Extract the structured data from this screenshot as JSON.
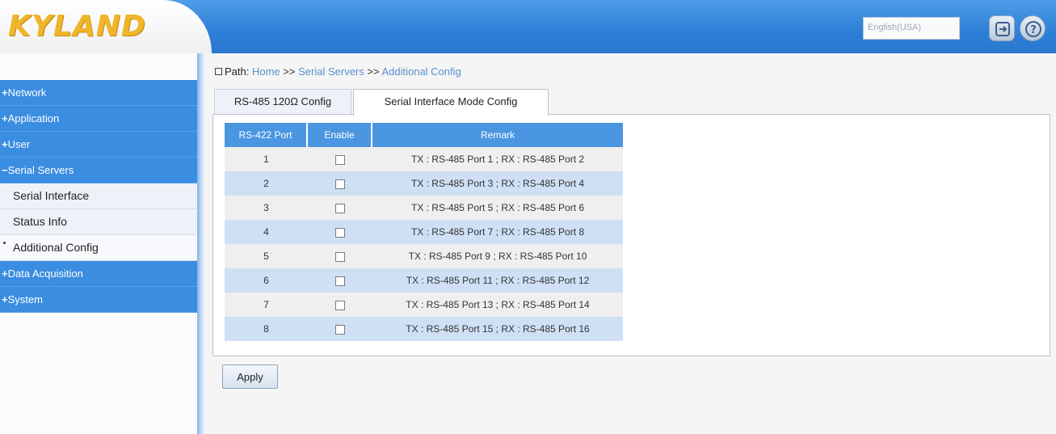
{
  "header": {
    "logo_text": "KYLAND",
    "language": "English(USA)",
    "logout_icon": "logout-icon",
    "help_icon": "help-icon"
  },
  "sidebar": {
    "items": [
      {
        "label": "Network",
        "sign": "+",
        "type": "group"
      },
      {
        "label": "Application",
        "sign": "+",
        "type": "group"
      },
      {
        "label": "User",
        "sign": "+",
        "type": "group"
      },
      {
        "label": "Serial Servers",
        "sign": "−",
        "type": "group"
      },
      {
        "label": "Serial Interface",
        "type": "sub"
      },
      {
        "label": "Status Info",
        "type": "sub"
      },
      {
        "label": "Additional Config",
        "type": "sub",
        "active": true
      },
      {
        "label": "Data Acquisition",
        "sign": "+",
        "type": "group"
      },
      {
        "label": "System",
        "sign": "+",
        "type": "group"
      }
    ]
  },
  "path": {
    "label": "Path:",
    "crumbs": [
      "Home",
      "Serial Servers",
      "Additional Config"
    ],
    "separator": ">>"
  },
  "tabs": [
    {
      "label": "RS-485 120Ω Config",
      "active": false
    },
    {
      "label": "Serial Interface Mode Config",
      "active": true
    }
  ],
  "table": {
    "headers": [
      "RS-422 Port",
      "Enable",
      "Remark"
    ],
    "rows": [
      {
        "port": "1",
        "enabled": false,
        "remark": "TX : RS-485 Port 1 ; RX : RS-485 Port 2"
      },
      {
        "port": "2",
        "enabled": false,
        "remark": "TX : RS-485 Port 3 ; RX : RS-485 Port 4"
      },
      {
        "port": "3",
        "enabled": false,
        "remark": "TX : RS-485 Port 5 ; RX : RS-485 Port 6"
      },
      {
        "port": "4",
        "enabled": false,
        "remark": "TX : RS-485 Port 7 ; RX : RS-485 Port 8"
      },
      {
        "port": "5",
        "enabled": false,
        "remark": "TX : RS-485 Port 9 ; RX : RS-485 Port 10"
      },
      {
        "port": "6",
        "enabled": false,
        "remark": "TX : RS-485 Port 11 ; RX : RS-485 Port 12"
      },
      {
        "port": "7",
        "enabled": false,
        "remark": "TX : RS-485 Port 13 ; RX : RS-485 Port 14"
      },
      {
        "port": "8",
        "enabled": false,
        "remark": "TX : RS-485 Port 15 ; RX : RS-485 Port 16"
      }
    ]
  },
  "actions": {
    "apply_label": "Apply"
  },
  "colors": {
    "header_blue": "#2d7fd6",
    "menu_blue": "#3a8de0",
    "logo_gold": "#f0b52a",
    "row_alt": "#cfe0f5"
  }
}
